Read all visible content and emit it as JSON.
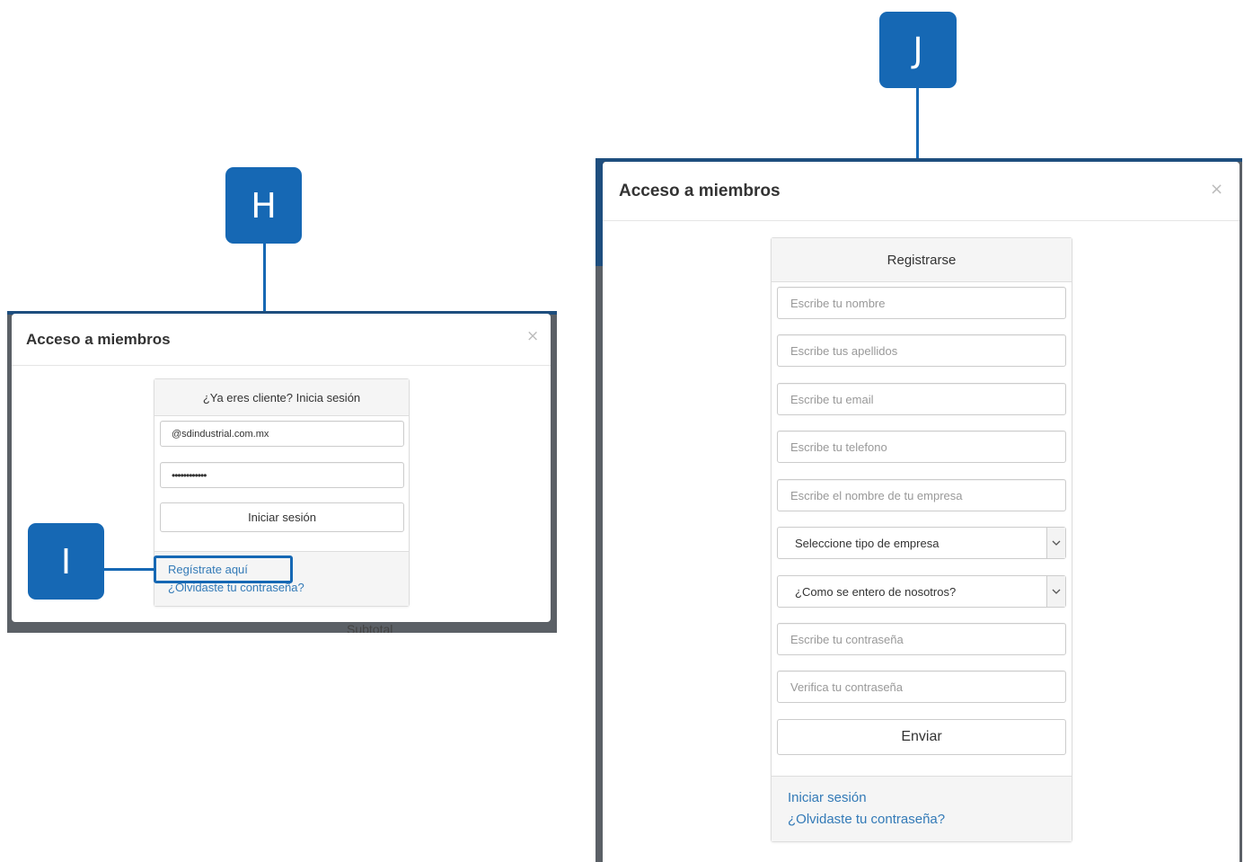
{
  "callouts": {
    "h": "H",
    "i": "I",
    "j": "J"
  },
  "login_modal": {
    "title": "Acceso a miembros",
    "close": "×",
    "panel_heading": "¿Ya eres cliente? Inicia sesión",
    "email_value": "@sdindustrial.com.mx",
    "password_value": "••••••••••••",
    "submit_label": "Iniciar sesión",
    "register_link": "Regístrate aquí",
    "forgot_link": "¿Olvidaste tu contraseña?",
    "background_text": "Subtotal"
  },
  "register_modal": {
    "title": "Acceso a miembros",
    "close": "×",
    "panel_heading": "Registrarse",
    "fields": {
      "name": "Escribe tu nombre",
      "lastname": "Escribe tus apellidos",
      "email": "Escribe tu email",
      "phone": "Escribe tu telefono",
      "company": "Escribe el nombre de tu empresa",
      "company_type": "Seleccione tipo de empresa",
      "source": "¿Como se entero de nosotros?",
      "password": "Escribe tu contraseña",
      "password_confirm": "Verifica tu contraseña"
    },
    "submit_label": "Enviar",
    "login_link": "Iniciar sesión",
    "forgot_link": "¿Olvidaste tu contraseña?"
  },
  "colors": {
    "accent": "#1668b4",
    "link": "#337ab7",
    "backdrop": "#5b6066"
  },
  "icons": {
    "close": "close-icon",
    "dropdown": "chevron-down-icon"
  }
}
